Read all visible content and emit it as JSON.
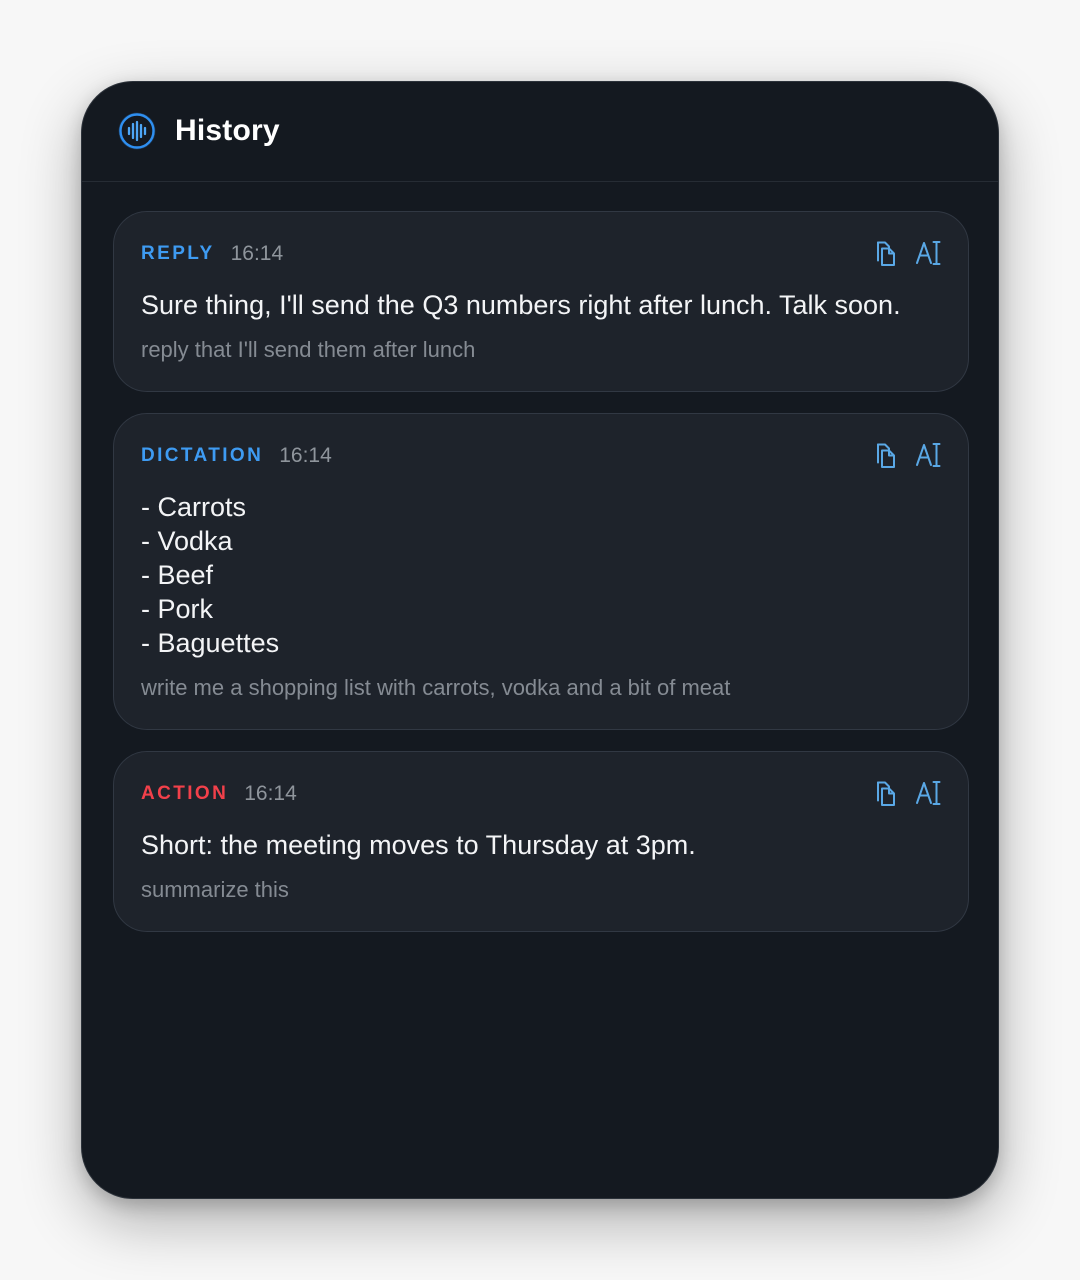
{
  "header": {
    "title": "History",
    "icon": "waveform-icon"
  },
  "colors": {
    "reply": "#3e9bf2",
    "dictation": "#3e9bf2",
    "action": "#f2404a",
    "icon": "#5aa8e6"
  },
  "cards": [
    {
      "type": "REPLY",
      "time": "16:14",
      "body": [
        "Sure thing, I'll send the Q3 numbers right after lunch. Talk soon."
      ],
      "prompt": "reply that I'll send them after lunch"
    },
    {
      "type": "DICTATION",
      "time": "16:14",
      "body": [
        "- Carrots",
        "- Vodka",
        "- Beef",
        "- Pork",
        "- Baguettes"
      ],
      "prompt": "write me a shopping list with carrots, vodka and a bit of meat"
    },
    {
      "type": "ACTION",
      "time": "16:14",
      "body": [
        "Short: the meeting moves to Thursday at 3pm."
      ],
      "prompt": "summarize this"
    }
  ]
}
